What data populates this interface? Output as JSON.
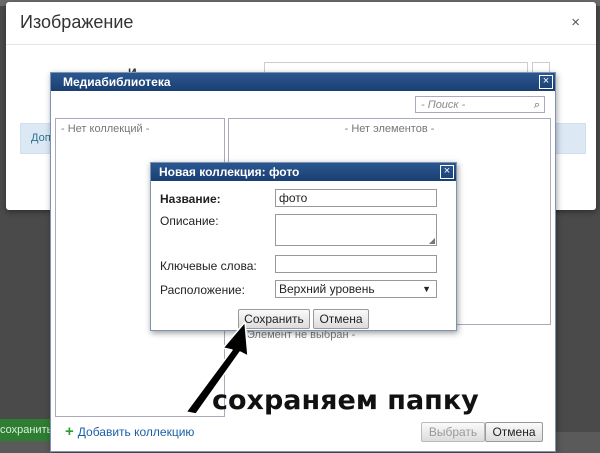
{
  "background": {
    "left_button_label": "сохранить"
  },
  "base_modal": {
    "title": "Изображение",
    "close_glyph": "×",
    "field_label": "И",
    "info_text": "Доп"
  },
  "media_library": {
    "title": "Медиабиблиотека",
    "close_glyph": "×",
    "search_placeholder": "- Поиск -",
    "collections_empty": "- Нет коллекций -",
    "elements_empty": "- Нет элементов -",
    "not_selected": "Элемент не выбран -",
    "add_collection": "Добавить коллекцию",
    "select_button": "Выбрать",
    "cancel_button": "Отмена"
  },
  "new_collection": {
    "title": "Новая коллекция: фото",
    "close_glyph": "×",
    "name_label": "Название:",
    "name_value": "фото",
    "description_label": "Описание:",
    "description_value": "",
    "keywords_label": "Ключевые слова:",
    "keywords_value": "",
    "location_label": "Расположение:",
    "location_value": "Верхний уровень",
    "save_button": "Сохранить",
    "cancel_button": "Отмена"
  },
  "annotation": {
    "caption": "сохраняем папку"
  },
  "colors": {
    "titlebar": "#1f4a82",
    "link": "#1a5fa8",
    "plus": "#2e9e2e",
    "info_bar": "#dce9f5"
  }
}
